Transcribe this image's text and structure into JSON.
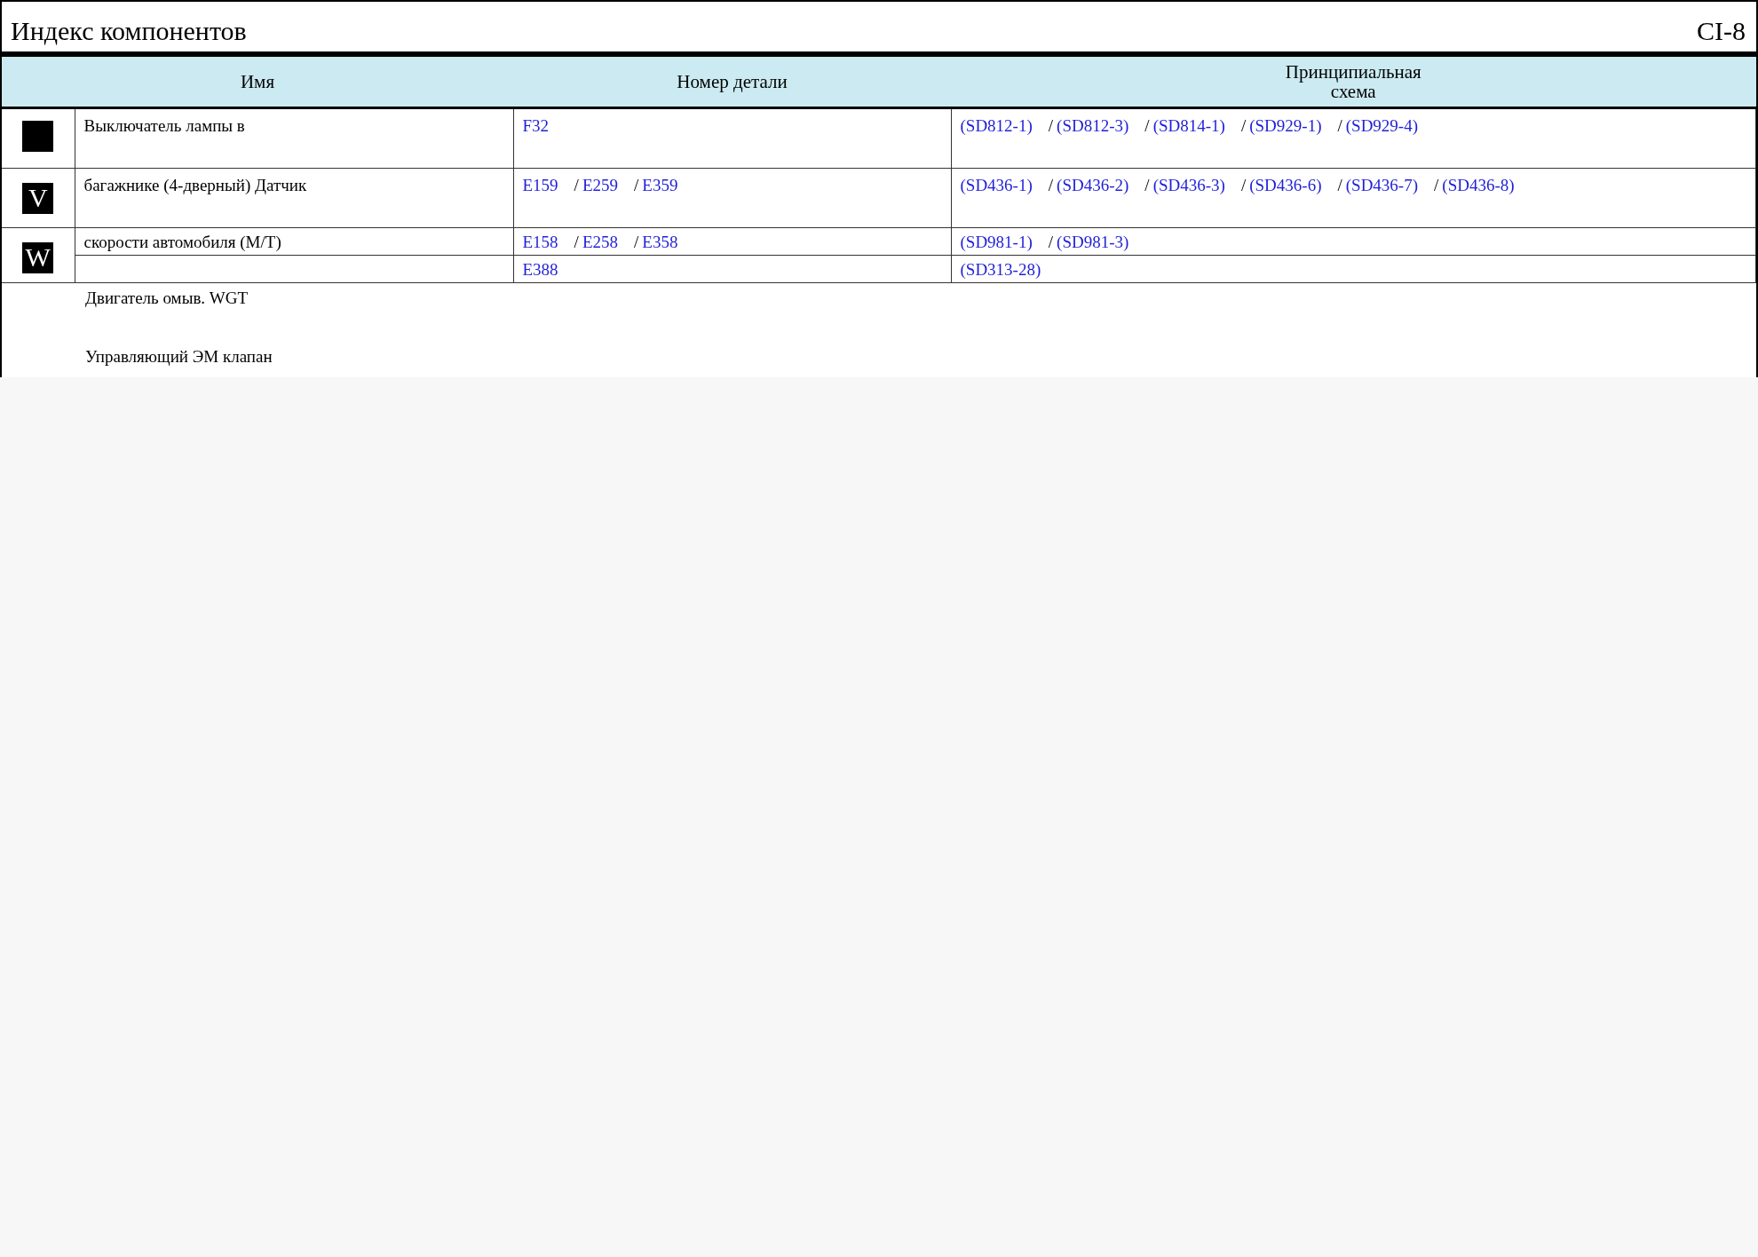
{
  "page": {
    "title": "Индекс компонентов",
    "page_code": "CI-8"
  },
  "table": {
    "columns": [
      "Имя",
      "Номер детали",
      "Принципиальная схема"
    ],
    "separator": "/",
    "groups": [
      {
        "marker": {
          "kind": "blank"
        },
        "lines": [
          {
            "name": "Выключатель лампы в",
            "parts": [
              "F32"
            ],
            "diagrams": [
              "(SD812-1)",
              "(SD812-3)",
              "(SD814-1)",
              "(SD929-1)",
              "(SD929-4)"
            ]
          }
        ]
      },
      {
        "marker": {
          "kind": "letter",
          "letter": "V"
        },
        "lines": [
          {
            "name": "багажнике (4-дверный) Датчик",
            "parts": [
              "E159",
              "E259",
              "E359"
            ],
            "diagrams": [
              "(SD436-1)",
              "(SD436-2)",
              "(SD436-3)",
              "(SD436-6)",
              "(SD436-7)",
              "(SD436-8)"
            ]
          }
        ]
      },
      {
        "marker": {
          "kind": "letter",
          "letter": "W"
        },
        "lines": [
          {
            "name": "скорости автомобиля (M/T)",
            "parts": [
              "E158",
              "E258",
              "E358"
            ],
            "diagrams": [
              "(SD981-1)",
              "(SD981-3)"
            ]
          },
          {
            "parts": [
              "E388"
            ],
            "diagrams": [
              "(SD313-28)"
            ]
          }
        ]
      }
    ]
  },
  "notes": [
    "Двигатель омыв. WGT",
    "Управляющий ЭМ клапан"
  ]
}
